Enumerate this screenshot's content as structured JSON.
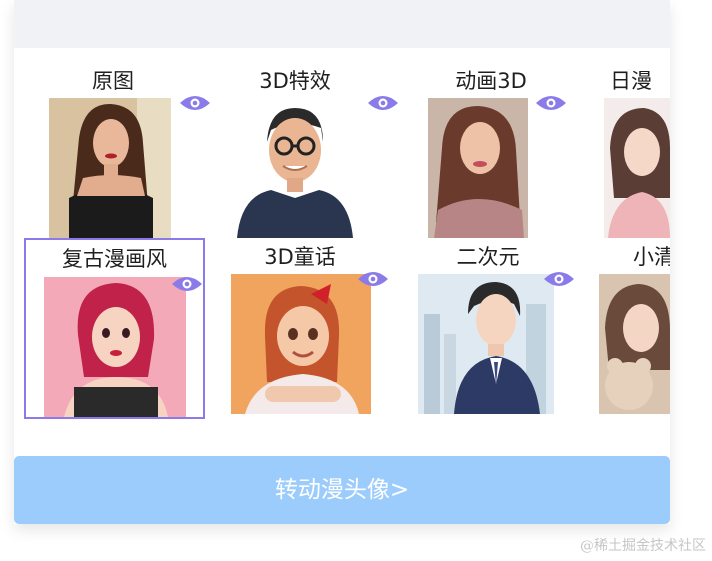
{
  "styles": [
    {
      "label": "原图",
      "selected": false
    },
    {
      "label": "3D特效",
      "selected": false
    },
    {
      "label": "动画3D",
      "selected": false
    },
    {
      "label": "日漫",
      "selected": false
    },
    {
      "label": "复古漫画风",
      "selected": true
    },
    {
      "label": "3D童话",
      "selected": false
    },
    {
      "label": "二次元",
      "selected": false
    },
    {
      "label": "小清",
      "selected": false
    }
  ],
  "preview_icon": "eye-icon",
  "accent_color": "#8a7be8",
  "button_color": "#9bccfb",
  "convert_button": "转动漫头像>",
  "watermark": "@稀土掘金技术社区"
}
